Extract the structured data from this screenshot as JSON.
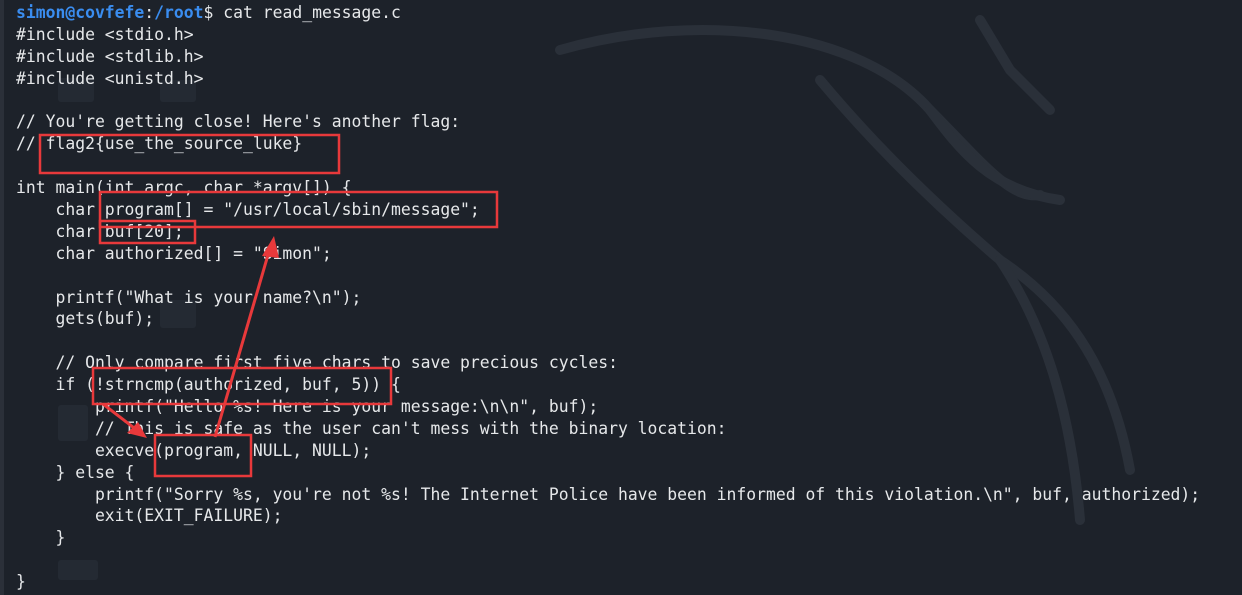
{
  "terminal": {
    "prompt": {
      "user_host": "simon@covfefe",
      "separator": ":",
      "path": "/root",
      "symbol": "$ ",
      "command": "cat read_message.c"
    },
    "lines": [
      "#include <stdio.h>",
      "#include <stdlib.h>",
      "#include <unistd.h>",
      "",
      "// You're getting close! Here's another flag:",
      "// flag2{use_the_source_luke}",
      "",
      "int main(int argc, char *argv[]) {",
      "    char program[] = \"/usr/local/sbin/message\";",
      "    char buf[20];",
      "    char authorized[] = \"Simon\";",
      "",
      "    printf(\"What is your name?\\n\");",
      "    gets(buf);",
      "",
      "    // Only compare first five chars to save precious cycles:",
      "    if (!strncmp(authorized, buf, 5)) {",
      "        printf(\"Hello %s! Here is your message:\\n\\n\", buf);",
      "        // This is safe as the user can't mess with the binary location:",
      "        execve(program, NULL, NULL);",
      "    } else {",
      "        printf(\"Sorry %s, you're not %s! The Internet Police have been informed of this violation.\\n\", buf, authorized);",
      "        exit(EXIT_FAILURE);",
      "    }",
      "",
      "}"
    ]
  },
  "colors": {
    "background": "#1d222a",
    "foreground": "#e6e8ea",
    "prompt": "#3a8df0",
    "annotation": "#e8393b"
  }
}
